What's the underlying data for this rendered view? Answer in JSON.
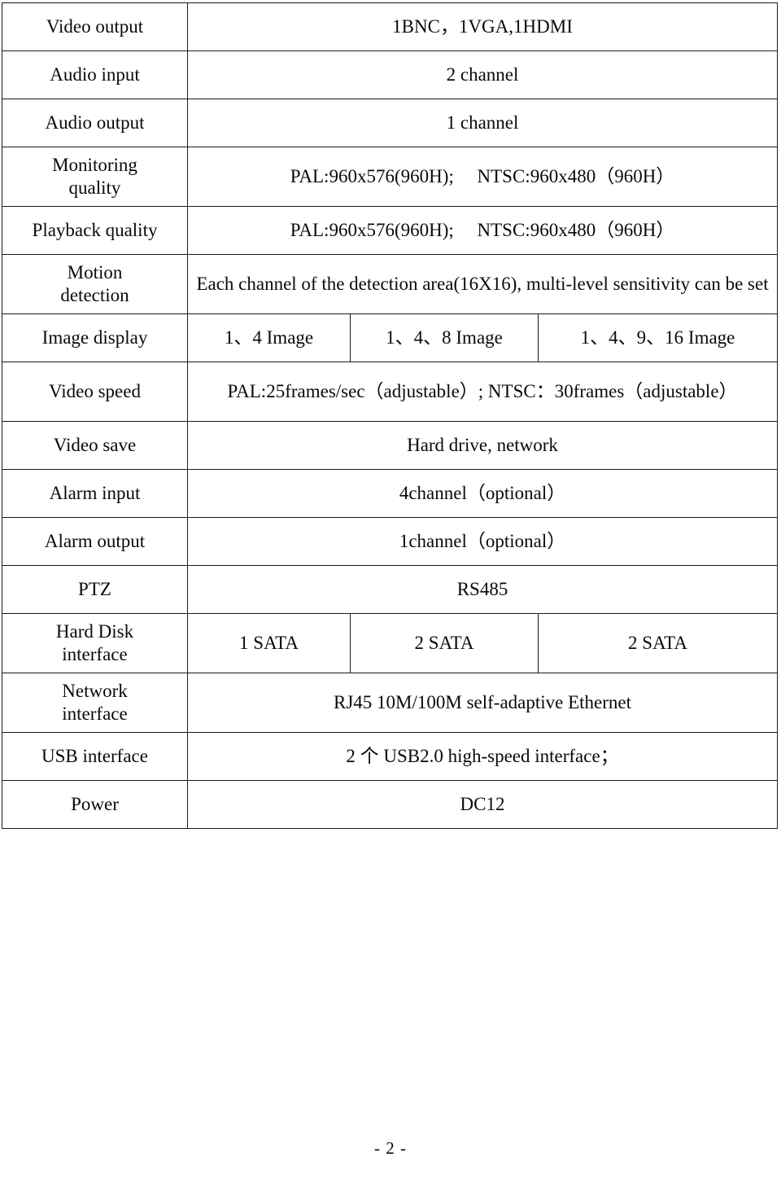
{
  "document": {
    "type": "specification-table",
    "page_number_label": "- 2 -"
  },
  "table": {
    "rows": [
      {
        "label": "Video output",
        "value": "1BNC，1VGA,1HDMI",
        "layout": "single",
        "label_lines": [
          "Video output"
        ]
      },
      {
        "label": "Audio input",
        "value": "2 channel",
        "layout": "single",
        "label_lines": [
          "Audio input"
        ]
      },
      {
        "label": "Audio output",
        "value": "1 channel",
        "layout": "single",
        "label_lines": [
          "Audio output"
        ]
      },
      {
        "label": "Monitoring quality",
        "value": "PAL:960x576(960H);　 NTSC:960x480（960H）",
        "layout": "single",
        "label_lines": [
          "Monitoring",
          "quality"
        ]
      },
      {
        "label": "Playback quality",
        "value": "PAL:960x576(960H);　 NTSC:960x480（960H）",
        "layout": "single",
        "label_lines": [
          "Playback quality"
        ]
      },
      {
        "label": "Motion detection",
        "value": "Each channel of the detection area(16X16), multi-level sensitivity can be set",
        "layout": "single",
        "label_lines": [
          "Motion",
          "detection"
        ]
      },
      {
        "label": "Image display",
        "layout": "triple",
        "label_lines": [
          "Image display"
        ],
        "values": [
          "1、4 Image",
          "1、4、8 Image",
          "1、4、9、16 Image"
        ]
      },
      {
        "label": "Video speed",
        "value": "PAL:25frames/sec（adjustable）; NTSC：30frames（adjustable）",
        "layout": "single",
        "label_lines": [
          "Video speed"
        ]
      },
      {
        "label": "Video save",
        "value": "Hard drive, network",
        "layout": "single",
        "label_lines": [
          "Video save"
        ]
      },
      {
        "label": "Alarm input",
        "value": "4channel（optional）",
        "layout": "single",
        "label_lines": [
          "Alarm input"
        ]
      },
      {
        "label": "Alarm output",
        "value": "1channel（optional）",
        "layout": "single",
        "label_lines": [
          "Alarm output"
        ]
      },
      {
        "label": "PTZ",
        "value": "RS485",
        "layout": "single",
        "label_lines": [
          "PTZ"
        ]
      },
      {
        "label": "Hard Disk interface",
        "layout": "triple",
        "label_lines": [
          "Hard Disk",
          "interface"
        ],
        "values": [
          "1 SATA",
          "2 SATA",
          "2 SATA"
        ]
      },
      {
        "label": "Network interface",
        "value": "RJ45 10M/100M self-adaptive Ethernet",
        "layout": "single",
        "label_lines": [
          "Network",
          "interface"
        ]
      },
      {
        "label": "USB interface",
        "value": "2 个 USB2.0 high-speed interface；",
        "layout": "single",
        "label_lines": [
          "USB interface"
        ]
      },
      {
        "label": "Power",
        "value": "DC12",
        "layout": "single",
        "label_lines": [
          "Power"
        ]
      }
    ]
  }
}
